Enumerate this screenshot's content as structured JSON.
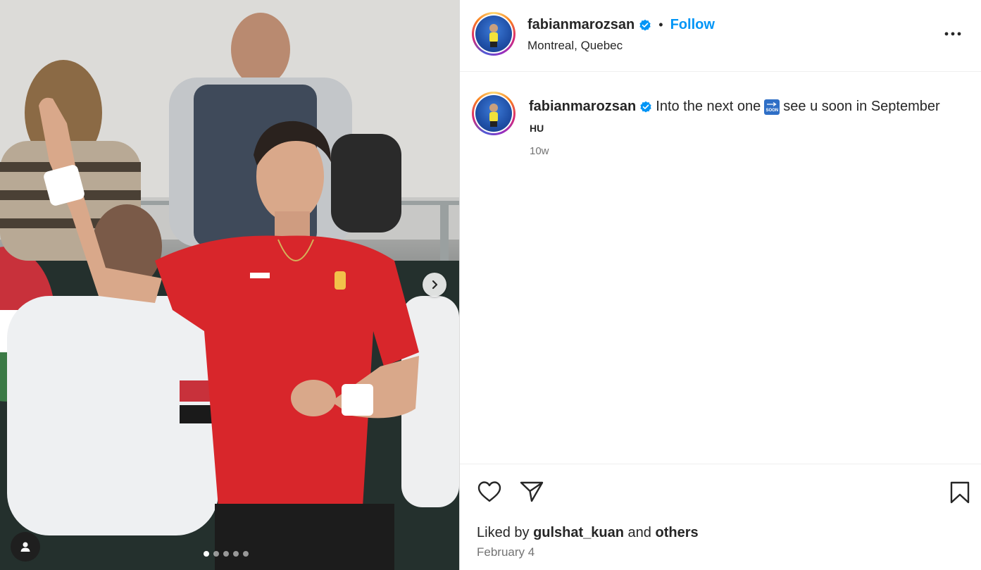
{
  "post": {
    "username": "fabianmarozsan",
    "location": "Montreal, Quebec",
    "follow_label": "Follow",
    "separator": "•",
    "caption": "Into the next one",
    "caption_emoji": "soon-arrow-emoji",
    "caption_emoji_text": "SOON",
    "caption_end": "see u soon in September",
    "caption_line2": "HU",
    "time_ago": "10w",
    "liked_by_prefix": "Liked by",
    "liked_by_user": "gulshat_kuan",
    "liked_by_and": "and",
    "liked_by_others": "others",
    "date": "February 4"
  },
  "carousel": {
    "total_slides": 5,
    "active_slide": 1
  },
  "icons": {
    "verified": "verified-badge-icon",
    "more": "more-options-icon",
    "like": "heart-icon",
    "share": "send-icon",
    "save": "bookmark-icon",
    "next": "chevron-right-icon",
    "tag": "user-tag-icon"
  },
  "colors": {
    "accent": "#0095f6",
    "verified": "#0095f6",
    "jersey": "#d8262b",
    "muted_text": "#737373"
  }
}
